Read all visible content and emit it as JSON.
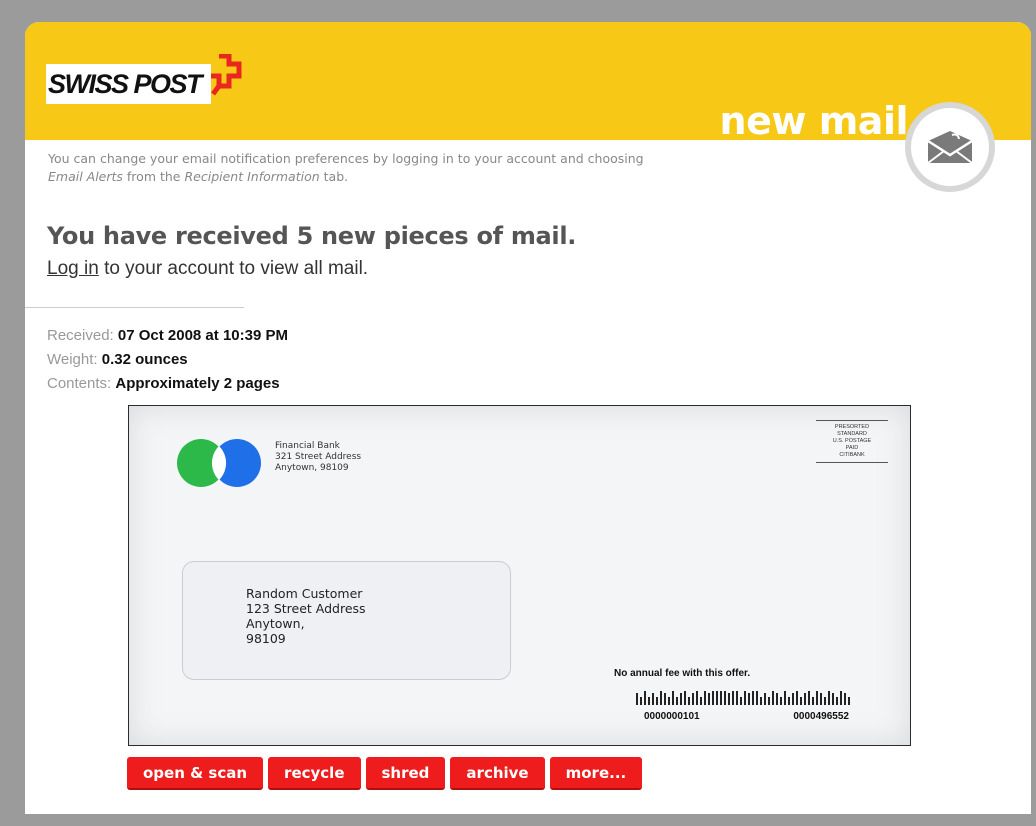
{
  "header": {
    "logo_text": "SWISS POST",
    "title": "new mail"
  },
  "notice": {
    "text_1": "You can change your email notification preferences by logging in to your account and choosing",
    "email_alerts": "Email Alerts",
    "text_2": "from the",
    "recipient_information": "Recipient Information",
    "text_3": "tab."
  },
  "headline": "You have received 5 new pieces of mail.",
  "login": {
    "link_text": "Log in",
    "rest_text": "to your account to view all mail."
  },
  "details": {
    "received_label": "Received:",
    "received_value": "07 Oct 2008 at 10:39 PM",
    "weight_label": "Weight:",
    "weight_value": "0.32 ounces",
    "contents_label": "Contents:",
    "contents_value": "Approximately 2 pages"
  },
  "envelope": {
    "return_address": [
      "Financial Bank",
      "321 Street Address",
      "Anytown, 98109"
    ],
    "postage_lines": [
      "PRESORTED",
      "STANDARD",
      "U.S. POSTAGE",
      "PAID",
      "CITIBANK"
    ],
    "recipient_address": [
      "Random Customer",
      "123 Street Address",
      "Anytown,",
      "98109"
    ],
    "offer_text": "No annual fee with this offer.",
    "barcode_left": "0000000101",
    "barcode_right": "0000496552"
  },
  "actions": {
    "open_scan": "open & scan",
    "recycle": "recycle",
    "shred": "shred",
    "archive": "archive",
    "more": "more..."
  },
  "colors": {
    "header_yellow": "#f7c815",
    "button_red": "#ee1c1c",
    "logo_red": "#e8271f",
    "circle_green": "#2db84a",
    "circle_blue": "#1f6fe8"
  },
  "icons": {
    "logo": "swiss-cross-logo",
    "mail_badge": "envelope-icon",
    "bank_logo": "overlapping-circles-logo"
  }
}
